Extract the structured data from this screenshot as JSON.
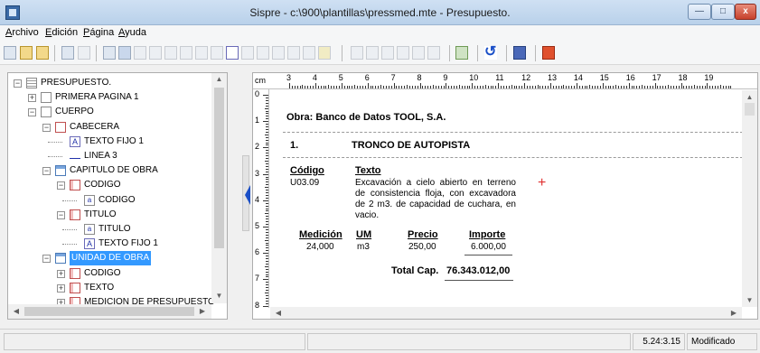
{
  "window": {
    "title": "Sispre - c:\\900\\plantillas\\pressmed.mte - Presupuesto.",
    "min_label": "—",
    "max_label": "□",
    "close_label": "x"
  },
  "menu": [
    "Archivo",
    "Edición",
    "Página",
    "Ayuda"
  ],
  "tree": {
    "items": [
      {
        "label": "PRESUPUESTO.",
        "icon": "doc-icon",
        "exp": "−"
      },
      {
        "label": "PRIMERA PAGINA 1",
        "icon": "page-icon",
        "exp": "+"
      },
      {
        "label": "CUERPO",
        "icon": "page-icon",
        "exp": "−"
      },
      {
        "label": "CABECERA",
        "icon": "page-red-icon",
        "exp": "−"
      },
      {
        "label": "TEXTO FIJO 1",
        "icon": "text-a-icon",
        "exp": ""
      },
      {
        "label": "LINEA 3",
        "icon": "line-icon",
        "exp": ""
      },
      {
        "label": "CAPITULO DE OBRA",
        "icon": "table-blue-icon",
        "exp": "−"
      },
      {
        "label": "CODIGO",
        "icon": "table-red-icon",
        "exp": "−"
      },
      {
        "label": "CODIGO",
        "icon": "field-icon",
        "exp": ""
      },
      {
        "label": "TITULO",
        "icon": "table-red-icon",
        "exp": "−"
      },
      {
        "label": "TITULO",
        "icon": "field-icon",
        "exp": ""
      },
      {
        "label": "TEXTO FIJO 1",
        "icon": "text-a-icon",
        "exp": ""
      },
      {
        "label": "UNIDAD DE OBRA",
        "icon": "table-blue-icon",
        "exp": "−",
        "selected": true
      },
      {
        "label": "CODIGO",
        "icon": "table-red-icon",
        "exp": "+"
      },
      {
        "label": "TEXTO",
        "icon": "table-red-icon",
        "exp": "+"
      },
      {
        "label": "MEDICION DE PRESUPUESTO",
        "icon": "table-red-icon",
        "exp": "+"
      }
    ]
  },
  "ruler": {
    "unit": "cm",
    "top_numbers": [
      "3",
      "4",
      "5",
      "6",
      "7",
      "8",
      "9",
      "10",
      "11",
      "12",
      "13",
      "14",
      "15",
      "16",
      "17",
      "18",
      "19"
    ],
    "left_numbers": [
      "0",
      "1",
      "2",
      "3",
      "4",
      "5",
      "6",
      "7",
      "8"
    ]
  },
  "document": {
    "obra_line": "Obra: Banco de Datos TOOL, S.A.",
    "chapter_number": "1.",
    "chapter_title": "TRONCO DE AUTOPISTA",
    "col_codigo": "Código",
    "col_texto": "Texto",
    "unit_code": "U03.09",
    "unit_text": "Excavación a cielo abierto en terreno de consistencia floja, con excavadora de 2 m3. de capacidad de cuchara, en vacio.",
    "col_medicion": "Medición",
    "col_um": "UM",
    "col_precio": "Precio",
    "col_importe": "Importe",
    "medicion": "24,000",
    "um": "m3",
    "precio": "250,00",
    "importe": "6.000,00",
    "total_label": "Total Cap.",
    "total_value": "76.343.012,00",
    "cursor": "+"
  },
  "status": {
    "coords": "5.24:3.15",
    "state": "Modificado"
  },
  "colors": {
    "selection": "#3399ff",
    "split_arrow": "#1a4fc7",
    "cursor_mark": "#e03030"
  }
}
